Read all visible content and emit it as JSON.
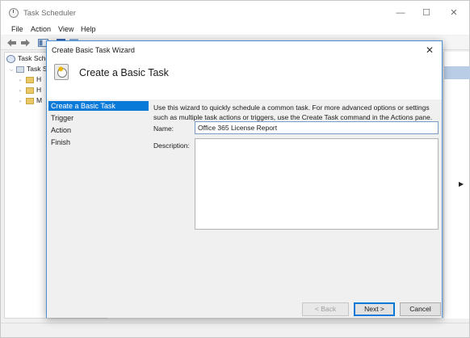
{
  "app": {
    "title": "Task Scheduler",
    "window_controls": {
      "minimize": "—",
      "maximize": "☐",
      "close": "✕"
    }
  },
  "menu": [
    "File",
    "Action",
    "View",
    "Help"
  ],
  "tree": {
    "root_label": "Task Sche",
    "library_label": "Task S",
    "children": [
      "H",
      "H",
      "M"
    ]
  },
  "wizard": {
    "title": "Create Basic Task Wizard",
    "close_glyph": "✕",
    "heading": "Create a Basic Task",
    "steps": [
      "Create a Basic Task",
      "Trigger",
      "Action",
      "Finish"
    ],
    "active_step": 0,
    "intro": "Use this wizard to quickly schedule a common task.  For more advanced options or settings such as multiple task actions or triggers, use the Create Task command in the Actions pane.",
    "name_label": "Name:",
    "name_value": "Office 365 License Report",
    "description_label": "Description:",
    "description_value": "",
    "buttons": {
      "back": "< Back",
      "next": "Next >",
      "cancel": "Cancel"
    }
  },
  "colors": {
    "accent": "#0a7ad9",
    "dialog_border": "#4a8fd6",
    "actions_highlight": "#b9cde6"
  }
}
